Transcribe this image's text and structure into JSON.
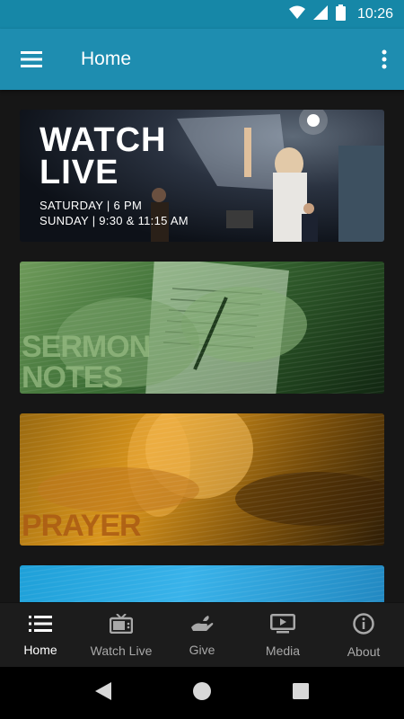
{
  "status_bar": {
    "time": "10:26",
    "icons": [
      "wifi-icon",
      "cell-signal-icon",
      "battery-icon"
    ]
  },
  "app_bar": {
    "title": "Home",
    "menu_icon": "hamburger-menu-icon",
    "more_icon": "more-vert-icon"
  },
  "colors": {
    "app_bar": "#1e8db0",
    "status_bar": "#1687a7",
    "background": "#161616",
    "nav_active": "#ffffff",
    "nav_inactive": "#a8a8a8"
  },
  "cards": [
    {
      "name": "watch-live-card",
      "title_line1": "WATCH",
      "title_line2": "LIVE",
      "schedule_line1": "SATURDAY | 6 PM",
      "schedule_line2": "SUNDAY | 9:30 & 11:15 AM"
    },
    {
      "name": "sermon-notes-card",
      "title_line1": "SERMON",
      "title_line2": "NOTES"
    },
    {
      "name": "prayer-card",
      "title_line1": "PRAYER"
    },
    {
      "name": "blue-card"
    }
  ],
  "bottom_nav": {
    "items": [
      {
        "label": "Home",
        "icon": "list-icon",
        "active": true
      },
      {
        "label": "Watch Live",
        "icon": "tv-icon",
        "active": false
      },
      {
        "label": "Give",
        "icon": "give-hand-icon",
        "active": false
      },
      {
        "label": "Media",
        "icon": "play-screen-icon",
        "active": false
      },
      {
        "label": "About",
        "icon": "info-icon",
        "active": false
      }
    ]
  },
  "system_nav": {
    "icons": [
      "back-icon",
      "home-circle-icon",
      "recents-icon"
    ]
  }
}
